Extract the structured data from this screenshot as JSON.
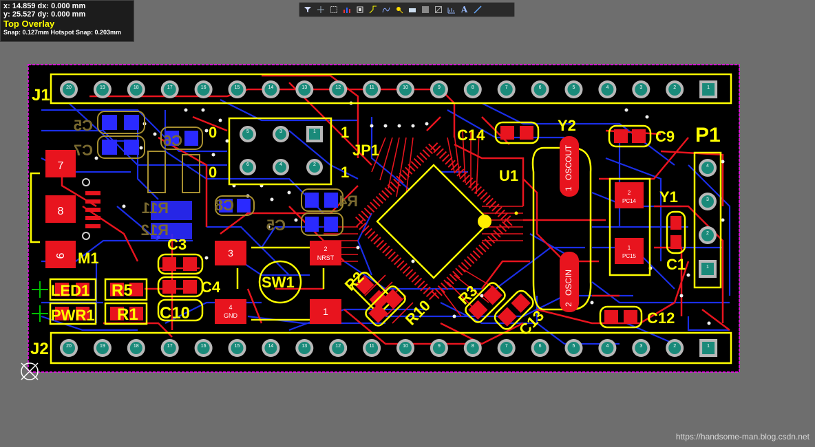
{
  "hud": {
    "x_line": "x: 14.859   dx:  0.000 mm",
    "y_line": "y: 25.527   dy:  0.000 mm",
    "layer": "Top Overlay",
    "snap": "Snap: 0.127mm Hotspot Snap: 0.203mm"
  },
  "toolbar": {
    "icons": [
      "filter-icon",
      "cross-icon",
      "select-rect-icon",
      "chart-icon",
      "component-icon",
      "route-icon",
      "arc-icon",
      "probe-icon",
      "fill-icon",
      "region-icon",
      "board-icon",
      "measure-icon",
      "text-icon",
      "line-icon"
    ]
  },
  "designators": {
    "j1": "J1",
    "j2": "J2",
    "p1": "P1",
    "u1": "U1",
    "y1": "Y1",
    "y2": "Y2",
    "jp1": "JP1",
    "sw1": "SW1",
    "m1": "M1",
    "c1": "C1",
    "c3": "C3",
    "c4": "C4",
    "c9": "C9",
    "c10": "C10",
    "c12": "C12",
    "c13": "C13",
    "c14": "C14",
    "r1": "R1",
    "r2": "R2",
    "r3": "R3",
    "r5": "R5",
    "r10": "R10",
    "led1": "LED1",
    "pwr1": "PWR1",
    "c5": "C5",
    "c7": "C7",
    "c6": "C6",
    "r4": "R4",
    "r11": "R11",
    "r12": "R12",
    "c8": "C8",
    "cs": "C5",
    "jp_0a": "0",
    "jp_0b": "0",
    "jp_1a": "1",
    "jp_1b": "1"
  },
  "pads": {
    "sw_3": "3",
    "sw_2": "2",
    "sw_nrst": "NRST",
    "sw_4": "4",
    "sw_gnd": "GND",
    "sw_1": "1",
    "usb_7": "7",
    "usb_8": "8",
    "usb_9": "9",
    "y2_1": "1",
    "y2_oscout": "OSCOUT",
    "y2_2": "2",
    "y2_oscin": "OSCIN",
    "y1_2": "2",
    "y1_pc14": "PC14",
    "y1_1": "1",
    "y1_pc15": "PC15",
    "jp_pads": [
      "5",
      "3",
      "1",
      "6",
      "4",
      "2"
    ]
  },
  "j1_pins": [
    "20",
    "19",
    "18",
    "17",
    "16",
    "15",
    "14",
    "13",
    "12",
    "11",
    "10",
    "9",
    "8",
    "7",
    "6",
    "5",
    "4",
    "3",
    "2",
    "1"
  ],
  "j2_pins": [
    "20",
    "19",
    "18",
    "17",
    "16",
    "15",
    "14",
    "13",
    "12",
    "11",
    "10",
    "9",
    "8",
    "7",
    "6",
    "5",
    "4",
    "3",
    "2",
    "1"
  ],
  "p1_pins": [
    "4",
    "3",
    "2",
    "1"
  ],
  "watermark": "https://handsome-man.blog.csdn.net"
}
